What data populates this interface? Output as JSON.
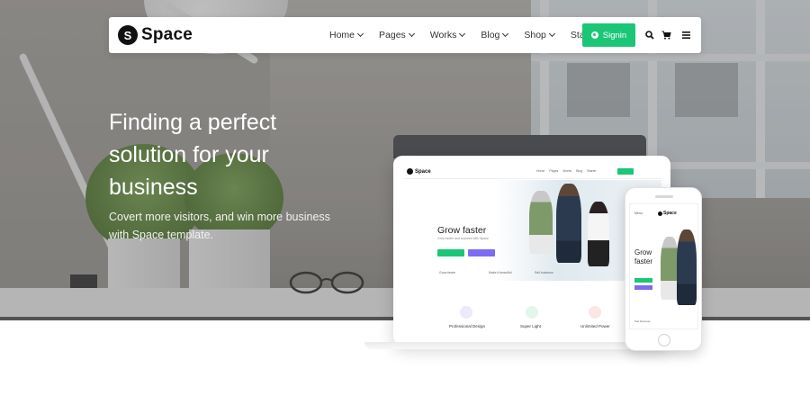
{
  "navbar": {
    "logo_mark": "S",
    "logo_text": "Space",
    "menu": [
      {
        "label": "Home",
        "has_dropdown": true
      },
      {
        "label": "Pages",
        "has_dropdown": true
      },
      {
        "label": "Works",
        "has_dropdown": true
      },
      {
        "label": "Blog",
        "has_dropdown": true
      },
      {
        "label": "Shop",
        "has_dropdown": true
      },
      {
        "label": "Starter",
        "has_dropdown": false
      }
    ],
    "signin_label": "Signin",
    "icons": [
      "search-icon",
      "cart-icon",
      "hamburger-icon"
    ]
  },
  "hero": {
    "title": "Finding a perfect solution for your business",
    "subtitle": "Covert more visitors, and win more business with Space template."
  },
  "laptop_screen": {
    "logo_text": "Space",
    "menu": [
      "Home",
      "Pages",
      "Works",
      "Blog",
      "Starter"
    ],
    "title": "Grow faster",
    "subtitle": "Grow faster and succeed with Space",
    "btn_primary": "Get Started",
    "btn_secondary": "Learn More",
    "features_row": [
      "Grow faster",
      "Make it beautiful",
      "Sell business"
    ],
    "feature_cards": [
      "Professional Design",
      "Super Light",
      "Unlimited Power"
    ]
  },
  "phone_screen": {
    "menu_label": "Menu",
    "logo_text": "Space",
    "title": "Grow faster",
    "feature_label": "Sell business"
  },
  "colors": {
    "accent_green": "#1bc677",
    "accent_purple": "#7c6cf3",
    "text_dark": "#111111"
  }
}
